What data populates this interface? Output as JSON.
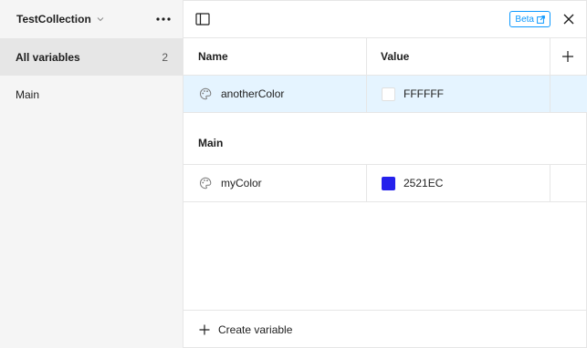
{
  "sidebar": {
    "collection_name": "TestCollection",
    "items": [
      {
        "label": "All variables",
        "count": "2"
      },
      {
        "label": "Main"
      }
    ]
  },
  "topbar": {
    "beta_label": "Beta"
  },
  "table": {
    "headers": {
      "name": "Name",
      "value": "Value"
    },
    "ungrouped_rows": [
      {
        "name": "anotherColor",
        "value": "FFFFFF",
        "swatch_color": "#FFFFFF"
      }
    ],
    "groups": [
      {
        "title": "Main",
        "rows": [
          {
            "name": "myColor",
            "value": "2521EC",
            "swatch_color": "#2521EC"
          }
        ]
      }
    ]
  },
  "footer": {
    "create_label": "Create variable"
  },
  "colors": {
    "accent": "#0d99ff",
    "selected_row": "#e5f4ff"
  }
}
